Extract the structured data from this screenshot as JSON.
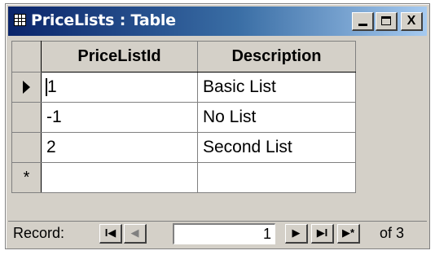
{
  "window": {
    "title": "PriceLists : Table",
    "controls": {
      "minimize": "_",
      "maximize": "",
      "close": "X"
    }
  },
  "grid": {
    "columns": [
      "PriceListId",
      "Description"
    ],
    "rows": [
      {
        "id": "1",
        "description": "Basic List",
        "current": true
      },
      {
        "id": "-1",
        "description": "No List",
        "current": false
      },
      {
        "id": "2",
        "description": "Second List",
        "current": false
      }
    ],
    "new_row_marker": "*"
  },
  "navigation": {
    "label": "Record:",
    "first": "I◀",
    "previous": "◀",
    "current_record": "1",
    "next": "▶",
    "last": "▶I",
    "new": "▶*",
    "total_text": "of 3"
  }
}
